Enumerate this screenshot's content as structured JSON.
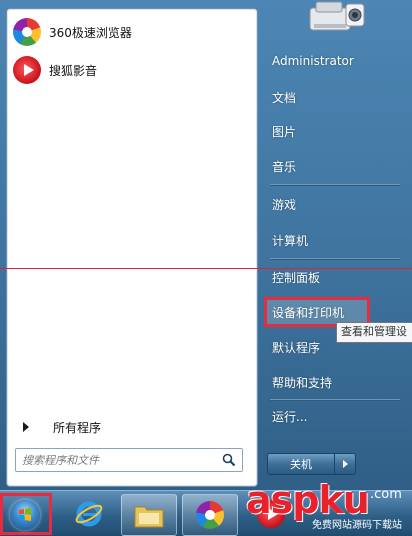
{
  "pinned_programs": [
    {
      "label": "360极速浏览器",
      "icon": "360-browser-icon"
    },
    {
      "label": "搜狐影音",
      "icon": "sohu-video-icon"
    }
  ],
  "all_programs": {
    "label": "所有程序"
  },
  "search": {
    "placeholder": "搜索程序和文件",
    "value": ""
  },
  "right_menu": {
    "user": "Administrator",
    "documents": "文档",
    "pictures": "图片",
    "music": "音乐",
    "games": "游戏",
    "computer": "计算机",
    "control_panel": "控制面板",
    "devices_printers": "设备和打印机",
    "default_programs": "默认程序",
    "help": "帮助和支持",
    "run": "运行..."
  },
  "tooltip": {
    "text": "查看和管理设"
  },
  "shutdown": {
    "label": "关机"
  },
  "watermark": {
    "main": "aspku",
    "small": ".com",
    "sub": "免费网站源码下载站"
  },
  "colors": {
    "highlight_red": "#e52d3f",
    "menu_blue": "#3e739e",
    "taskbar_blue": "#2f6088"
  },
  "taskbar_items": [
    "start-orb",
    "ie-icon",
    "explorer-icon",
    "360-browser-icon",
    "sohu-video-icon"
  ]
}
